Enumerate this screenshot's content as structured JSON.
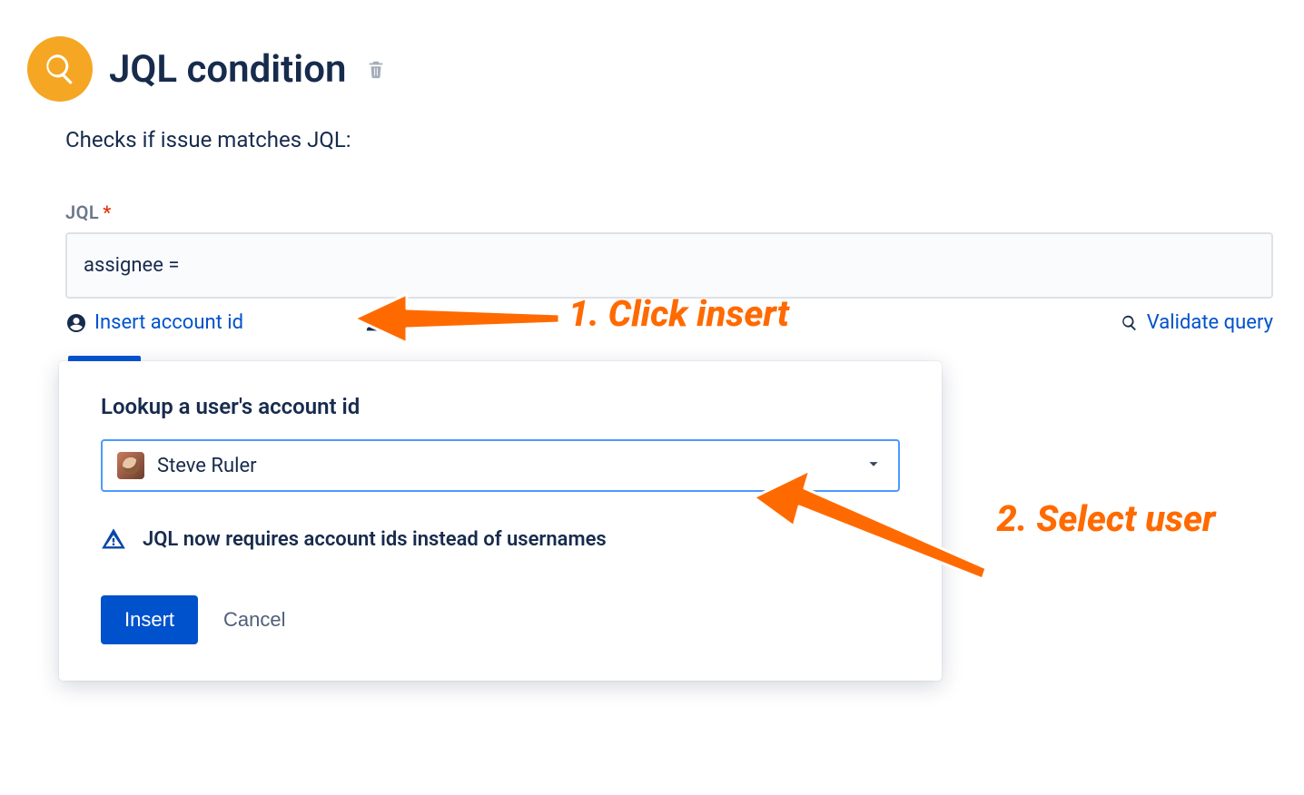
{
  "header": {
    "title": "JQL condition"
  },
  "subtitle": "Checks if issue matches JQL:",
  "field": {
    "label": "JQL",
    "required_marker": "*",
    "value": "assignee ="
  },
  "links": {
    "insert_account_id": "Insert account id",
    "validate_query": "Validate query"
  },
  "popup": {
    "title": "Lookup a user's account id",
    "selected_user": "Steve Ruler",
    "info": "JQL now requires account ids instead of usernames",
    "insert_label": "Insert",
    "cancel_label": "Cancel"
  },
  "annotations": {
    "step1": "1. Click insert",
    "step2": "2. Select user"
  },
  "colors": {
    "accent_orange": "#ff6a00",
    "primary_blue": "#0052cc",
    "icon_bg": "#f5a623"
  }
}
